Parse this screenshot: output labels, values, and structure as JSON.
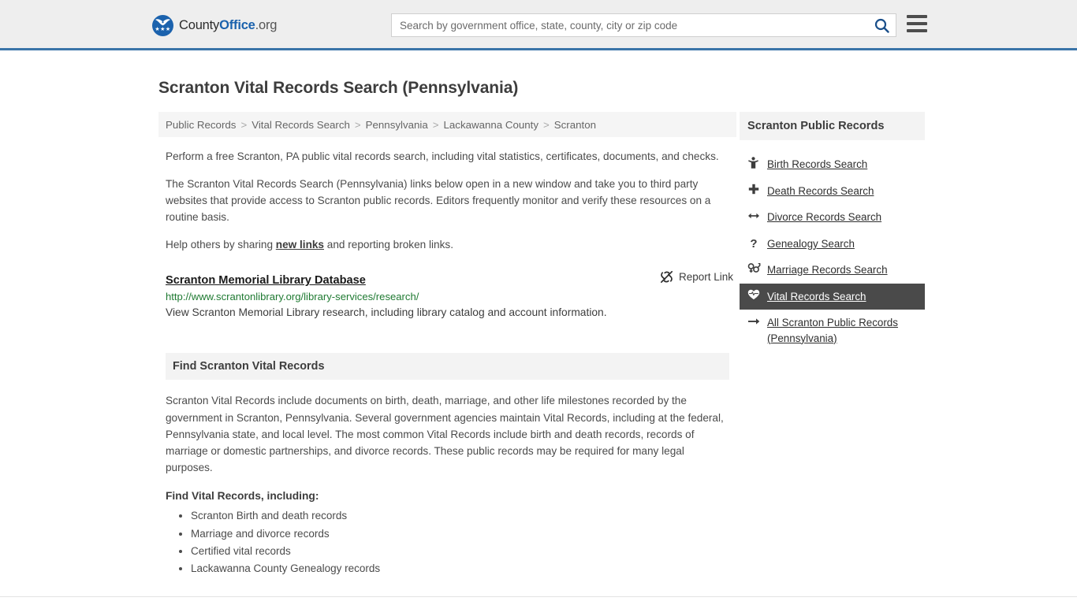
{
  "header": {
    "logo": {
      "name_part1": "County",
      "name_part2": "Office",
      "name_part3": ".org",
      "stars": "★★★"
    },
    "search": {
      "placeholder": "Search by government office, state, county, city or zip code",
      "value": "",
      "icon": "search-icon",
      "accent_color": "#1a4f8a"
    },
    "menu_icon": "hamburger-menu-icon",
    "border_color": "#3a74a8"
  },
  "main": {
    "page_title": "Scranton Vital Records Search (Pennsylvania)",
    "breadcrumb": [
      "Public Records",
      "Vital Records Search",
      "Pennsylvania",
      "Lackawanna County",
      "Scranton"
    ],
    "breadcrumb_separator": ">",
    "intro_p1": "Perform a free Scranton, PA public vital records search, including vital statistics, certificates, documents, and checks.",
    "intro_p2": "The Scranton Vital Records Search (Pennsylvania) links below open in a new window and take you to third party websites that provide access to Scranton public records. Editors frequently monitor and verify these resources on a routine basis.",
    "help_prefix": "Help others by sharing ",
    "help_link": "new links",
    "help_suffix": " and reporting broken links.",
    "result": {
      "title": "Scranton Memorial Library Database",
      "url": "http://www.scrantonlibrary.org/library-services/research/",
      "description": "View Scranton Memorial Library research, including library catalog and account information.",
      "report_label": "Report Link",
      "report_icon": "broken-link-icon",
      "url_color": "#1f7a32"
    },
    "section": {
      "heading": "Find Scranton Vital Records",
      "body": "Scranton Vital Records include documents on birth, death, marriage, and other life milestones recorded by the government in Scranton, Pennsylvania. Several government agencies maintain Vital Records, including at the federal, Pennsylvania state, and local level. The most common Vital Records include birth and death records, records of marriage or domestic partnerships, and divorce records. These public records may be required for many legal purposes.",
      "list_label": "Find Vital Records, including:",
      "list_items": [
        "Scranton Birth and death records",
        "Marriage and divorce records",
        "Certified vital records",
        "Lackawanna County Genealogy records"
      ]
    }
  },
  "sidebar": {
    "heading": "Scranton Public Records",
    "active_background": "#4a4a4a",
    "items": [
      {
        "label": "Birth Records Search",
        "icon": "baby-icon",
        "glyph": "🚼",
        "active": false
      },
      {
        "label": "Death Records Search",
        "icon": "cross-icon",
        "glyph": "✚",
        "active": false
      },
      {
        "label": "Divorce Records Search",
        "icon": "left-right-arrow-icon",
        "glyph": "↔",
        "active": false
      },
      {
        "label": "Genealogy Search",
        "icon": "question-mark-icon",
        "glyph": "?",
        "active": false
      },
      {
        "label": "Marriage Records Search",
        "icon": "male-female-symbol-icon",
        "glyph": "⚥",
        "active": false
      },
      {
        "label": "Vital Records Search",
        "icon": "heart-pulse-icon",
        "glyph": "❤",
        "active": true
      },
      {
        "label": "All Scranton Public Records (Pennsylvania)",
        "icon": "arrow-right-icon",
        "glyph": "→",
        "active": false
      }
    ]
  }
}
